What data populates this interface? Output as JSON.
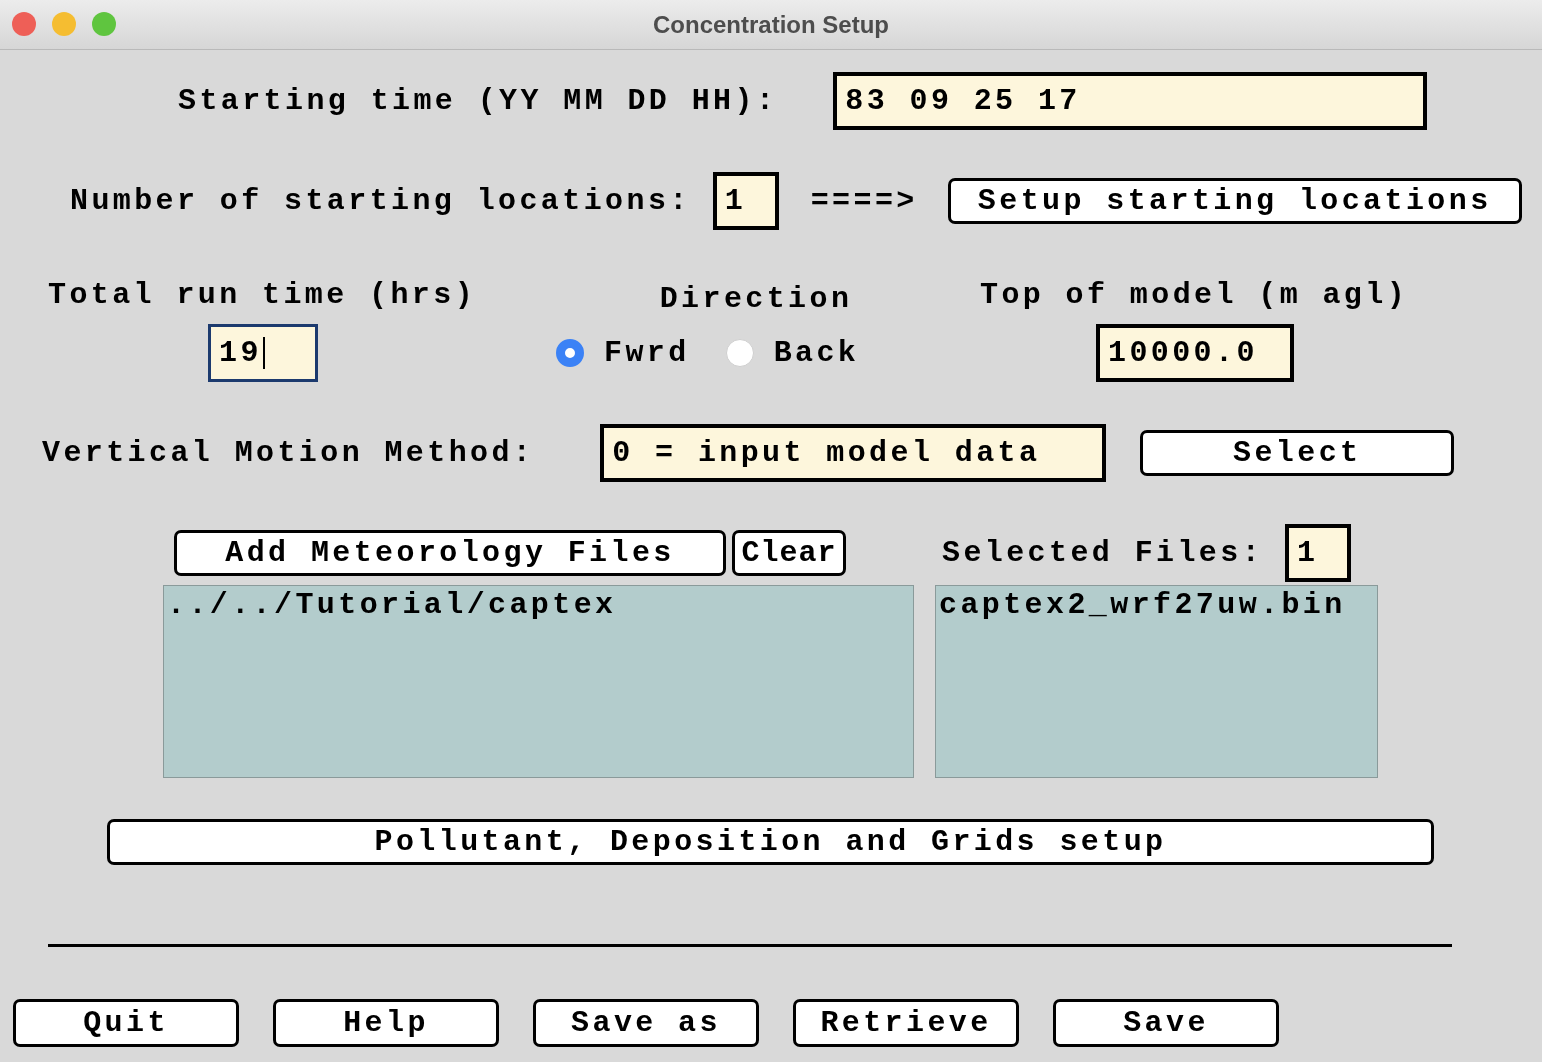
{
  "window": {
    "title": "Concentration Setup"
  },
  "starting_time": {
    "label": "Starting time (YY MM DD HH):",
    "value": "83 09 25 17"
  },
  "starting_locations": {
    "label": "Number of starting locations:",
    "value": "1",
    "arrow": "====>",
    "button": "Setup starting locations"
  },
  "run_time": {
    "label": "Total run time (hrs)",
    "value": "19",
    "focused": true
  },
  "direction": {
    "label": "Direction",
    "options": [
      {
        "label": "Fwrd",
        "selected": true
      },
      {
        "label": "Back",
        "selected": false
      }
    ]
  },
  "top_of_model": {
    "label": "Top of model (m agl)",
    "value": "10000.0"
  },
  "vertical_motion": {
    "label": "Vertical Motion Method:",
    "value": "0 = input model data",
    "button": "Select"
  },
  "meteorology": {
    "add_button": "Add Meteorology Files",
    "clear_button": "Clear",
    "selected_label": "Selected Files:",
    "selected_count": "1",
    "directories": [
      "../../Tutorial/captex"
    ],
    "files": [
      "captex2_wrf27uw.bin"
    ]
  },
  "setup_button": "Pollutant, Deposition and Grids setup",
  "buttons": [
    "Quit",
    "Help",
    "Save as",
    "Retrieve",
    "Save"
  ]
}
